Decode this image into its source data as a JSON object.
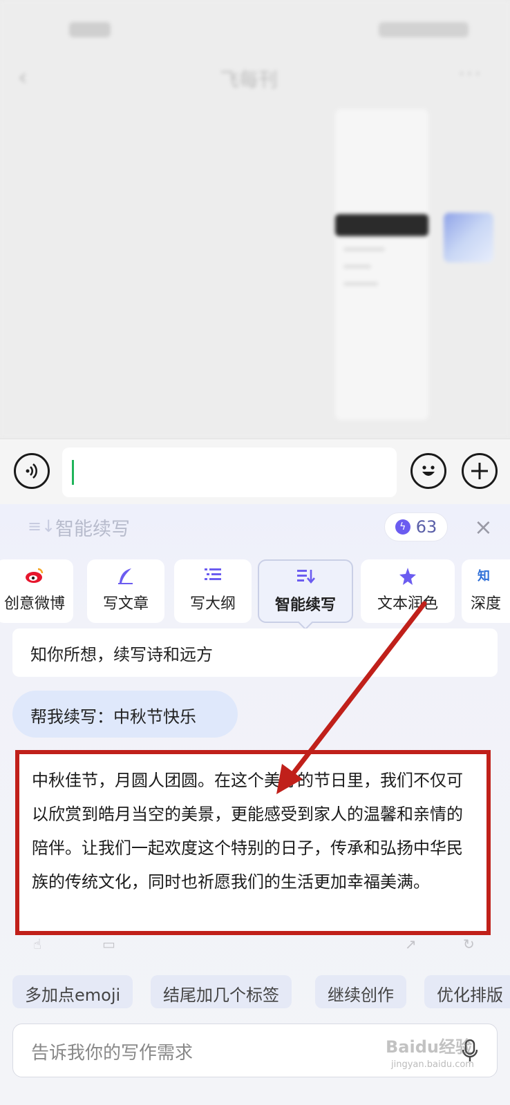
{
  "chat": {
    "title": "飞每刊",
    "more": "···"
  },
  "input": {
    "value": ""
  },
  "panel": {
    "title": "智能续写",
    "quota": "63",
    "tools": [
      {
        "label": "创意微博",
        "icon": "weibo-icon"
      },
      {
        "label": "写文章",
        "icon": "quill-icon"
      },
      {
        "label": "写大纲",
        "icon": "list-icon"
      },
      {
        "label": "智能续写",
        "icon": "continue-write-icon",
        "active": true
      },
      {
        "label": "文本润色",
        "icon": "sparkle-icon"
      },
      {
        "label": "深度",
        "icon": "zhi-icon",
        "icon_text": "知"
      }
    ],
    "intro": "知你所想，续写诗和远方",
    "user_prompt": "帮我续写：中秋节快乐",
    "answer": "中秋佳节，月圆人团圆。在这个美好的节日里，我们不仅可以欣赏到皓月当空的美景，更能感受到家人的温馨和亲情的陪伴。让我们一起欢度这个特别的日子，传承和弘扬中华民族的传统文化，同时也祈愿我们的生活更加幸福美满。",
    "suggestions": [
      "多加点emoji",
      "结尾加几个标签",
      "继续创作",
      "优化排版"
    ],
    "request_placeholder": "告诉我你的写作需求"
  },
  "colors": {
    "annotation": "#c0201a",
    "accent": "#6b5cf0",
    "caret": "#1fb45a"
  },
  "watermark": {
    "brand": "Baidu经验",
    "url": "jingyan.baidu.com"
  }
}
